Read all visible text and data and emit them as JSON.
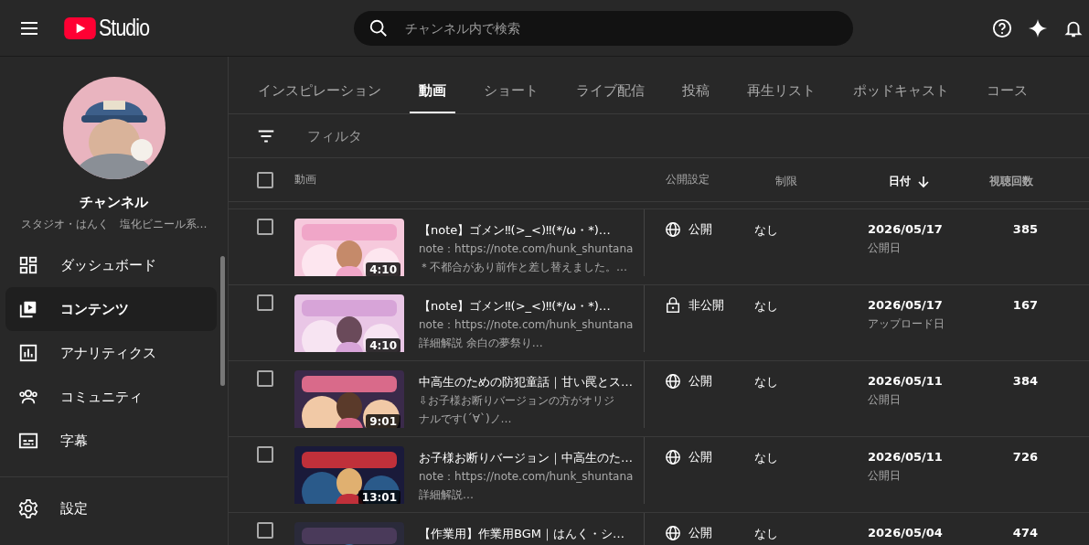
{
  "topbar": {
    "logo_text": "Studio",
    "search": {
      "placeholder": "チャンネル内で検索"
    }
  },
  "sidebar": {
    "channel_label": "チャンネル",
    "channel_name": "スタジオ・はんく　塩化ビニール系…",
    "items": [
      {
        "label": "ダッシュボード",
        "selected": false
      },
      {
        "label": "コンテンツ",
        "selected": true
      },
      {
        "label": "アナリティクス",
        "selected": false
      },
      {
        "label": "コミュニティ",
        "selected": false
      },
      {
        "label": "字幕",
        "selected": false
      }
    ],
    "settings": "設定"
  },
  "tabs": [
    {
      "label": "インスピレーション",
      "selected": false
    },
    {
      "label": "動画",
      "selected": true
    },
    {
      "label": "ショート",
      "selected": false
    },
    {
      "label": "ライブ配信",
      "selected": false
    },
    {
      "label": "投稿",
      "selected": false
    },
    {
      "label": "再生リスト",
      "selected": false
    },
    {
      "label": "ポッドキャスト",
      "selected": false
    },
    {
      "label": "コース",
      "selected": false
    }
  ],
  "filter": {
    "placeholder": "フィルタ"
  },
  "table": {
    "header_checked": false,
    "columns": [
      {
        "label": "動画",
        "sorted": false
      },
      {
        "label": "公開設定",
        "sorted": false
      },
      {
        "label": "制限",
        "sorted": false
      },
      {
        "label": "日付",
        "sorted": true
      },
      {
        "label": "視聴回数",
        "sorted": false
      }
    ],
    "rows": [
      {
        "checked": false,
        "duration": "4:10",
        "title": "【note】ゴメン‼(>_<)‼(*/ω・*)…",
        "desc": [
          "note：https://note.com/hunk_shuntana",
          "＊不都合があり前作と差し替えました。…"
        ],
        "kind": "public",
        "visibility": "公開",
        "restriction": "なし",
        "date": "2026/05/17",
        "date_note": "公開日",
        "views": "385"
      },
      {
        "checked": false,
        "duration": "4:10",
        "title": "【note】ゴメン‼(>_<)‼(*/ω・*)…",
        "desc": [
          "note：https://note.com/hunk_shuntana",
          "詳細解説 余白の夢祭り…"
        ],
        "kind": "private",
        "visibility": "非公開",
        "restriction": "なし",
        "date": "2026/05/17",
        "date_note": "アップロード日",
        "views": "167"
      },
      {
        "checked": false,
        "duration": "9:01",
        "title": "中高生のための防犯童話｜甘い罠とス…",
        "desc": [
          "⇩お子様お断りバージョンの方がオリジ",
          "ナルです(´∀`)ノ…"
        ],
        "kind": "public",
        "visibility": "公開",
        "restriction": "なし",
        "date": "2026/05/11",
        "date_note": "公開日",
        "views": "384"
      },
      {
        "checked": false,
        "duration": "13:01",
        "title": "お子様お断りバージョン｜中高生のた…",
        "desc": [
          "note：https://note.com/hunk_shuntana",
          "詳細解説…"
        ],
        "kind": "public",
        "visibility": "公開",
        "restriction": "なし",
        "date": "2026/05/11",
        "date_note": "公開日",
        "views": "726"
      },
      {
        "checked": false,
        "title": "【作業用】作業用BGM｜はんく・シ…",
        "kind": "public",
        "visibility": "公開",
        "restriction": "なし",
        "date": "2026/05/04",
        "views": "474"
      }
    ]
  }
}
